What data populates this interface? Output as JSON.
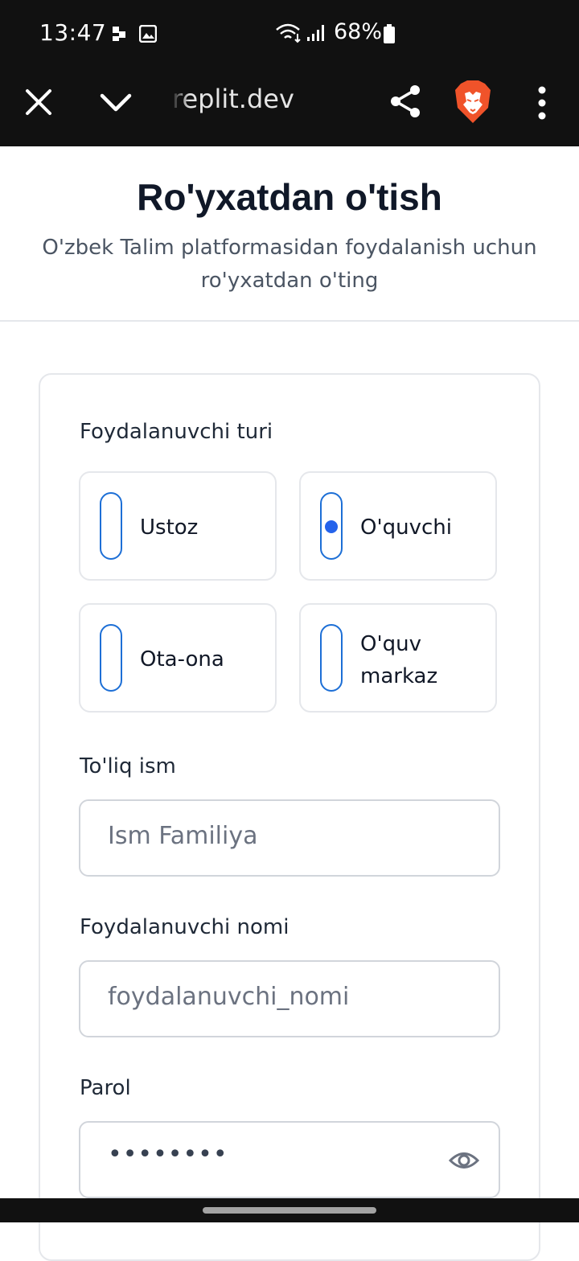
{
  "status_bar": {
    "time": "13:47",
    "battery": "68%"
  },
  "browser": {
    "url": "replit.dev"
  },
  "header": {
    "title": "Ro'yxatdan o'tish",
    "subtitle": "O'zbek Talim platformasidan foydalanish uchun ro'yxatdan o'ting"
  },
  "form": {
    "role_label": "Foydalanuvchi turi",
    "roles": [
      {
        "label": "Ustoz",
        "selected": false
      },
      {
        "label": "O'quvchi",
        "selected": true
      },
      {
        "label": "Ota-ona",
        "selected": false
      },
      {
        "label": "O'quv markaz",
        "selected": false
      }
    ],
    "fullname_label": "To'liq ism",
    "fullname_placeholder": "Ism Familiya",
    "username_label": "Foydalanuvchi nomi",
    "username_placeholder": "foydalanuvchi_nomi",
    "password_label": "Parol",
    "password_value": "••••••••"
  },
  "colors": {
    "accent": "#2563eb",
    "radio_border": "#1d6fd6",
    "brave": "#f0532a"
  }
}
